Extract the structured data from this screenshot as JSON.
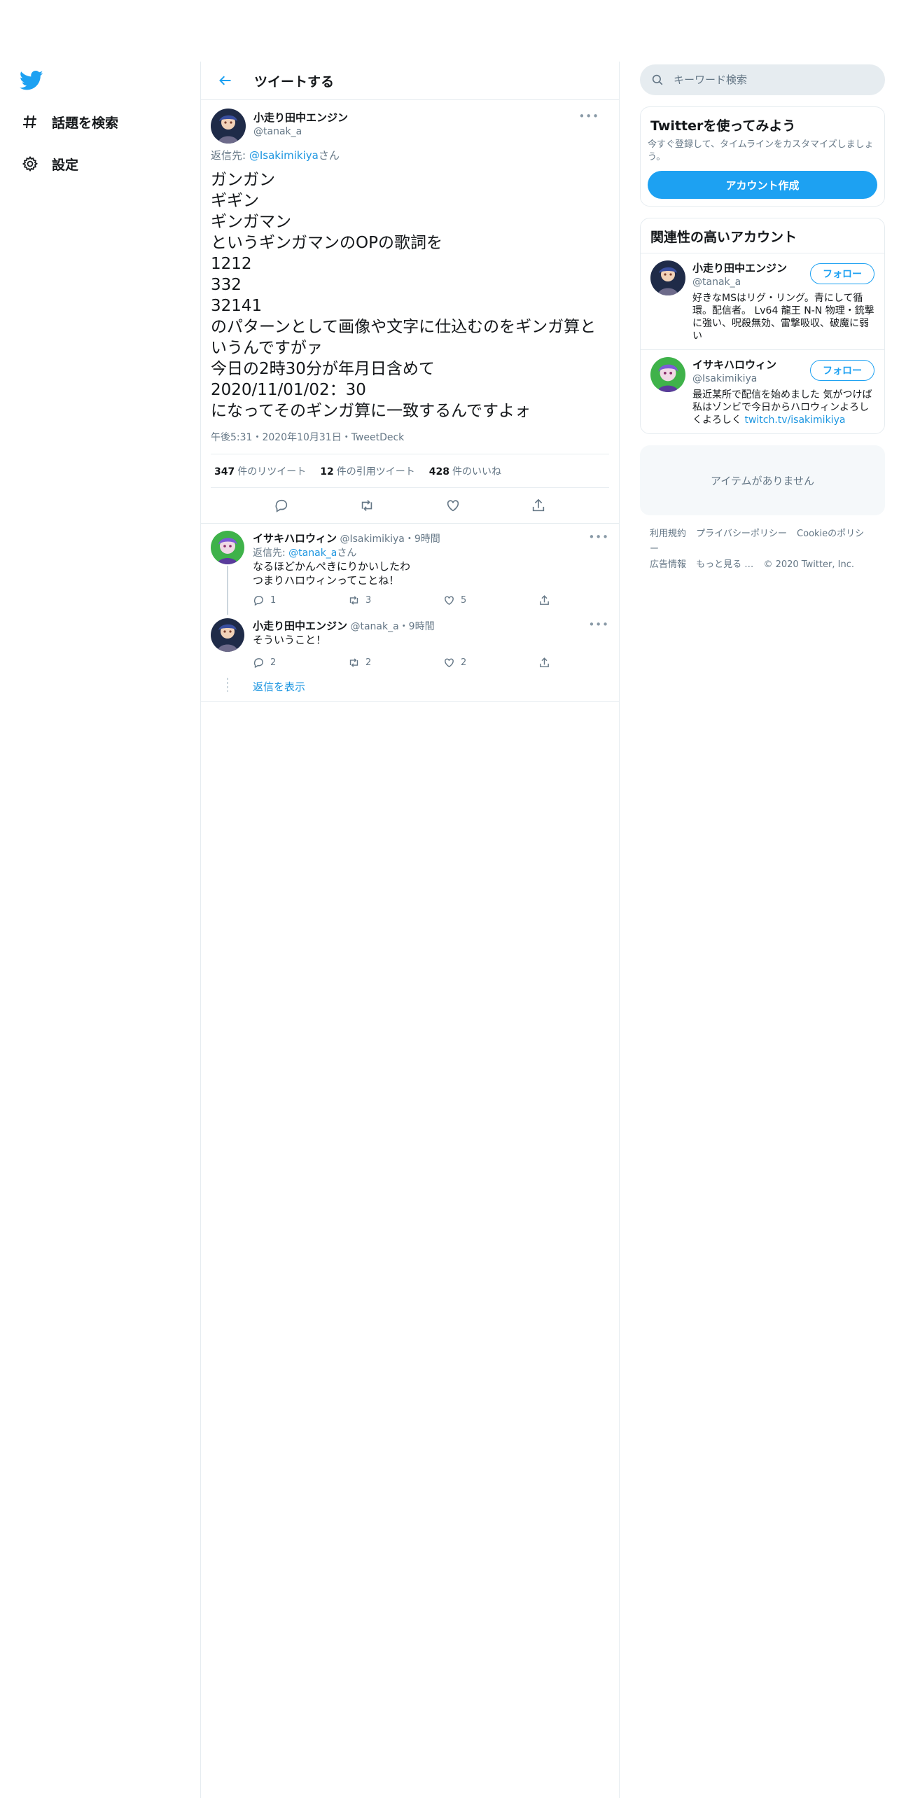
{
  "nav": {
    "items": [
      {
        "label": "話題を検索",
        "icon": "hashtag-icon"
      },
      {
        "label": "設定",
        "icon": "gear-icon"
      }
    ]
  },
  "header": {
    "title": "ツイートする"
  },
  "main_tweet": {
    "name": "小走り田中エンジン",
    "handle": "@tanak_a",
    "replying_prefix": "返信先: ",
    "replying_handle": "@Isakimikiya",
    "replying_suffix": "さん",
    "text": "ガンガン\nギギン\nギンガマン\nというギンガマンのOPの歌詞を\n1212\n332\n32141\nのパターンとして画像や文字に仕込むのをギンガ算と\nいうんですがァ\n今日の2時30分が年月日含めて\n2020/11/01/02：30\nになってそのギンガ算に一致するんですよォ",
    "meta": "午後5:31・2020年10月31日・TweetDeck",
    "retweets": "347",
    "retweets_label": "件のリツイート",
    "quotes": "12",
    "quotes_label": "件の引用ツイート",
    "likes": "428",
    "likes_label": "件のいいね"
  },
  "replies": [
    {
      "name": "イサキハロウィン",
      "handle": "@Isakimikiya",
      "time": "・9時間",
      "replying_prefix": "返信先: ",
      "replying_handle": "@tanak_a",
      "replying_suffix": "さん",
      "text": "なるほどかんぺきにりかいしたわ\nつまりハロウィンってことね！",
      "reply_count": "1",
      "retweet_count": "3",
      "like_count": "5"
    },
    {
      "name": "小走り田中エンジン",
      "handle": "@tanak_a",
      "time": "・9時間",
      "text": "そういうこと！",
      "reply_count": "2",
      "retweet_count": "2",
      "like_count": "2"
    }
  ],
  "show_replies": "返信を表示",
  "search": {
    "placeholder": "キーワード検索"
  },
  "signup": {
    "title": "Twitterを使ってみよう",
    "desc": "今すぐ登録して、タイムラインをカスタマイズしましょう。",
    "button": "アカウント作成"
  },
  "related": {
    "title": "関連性の高いアカウント",
    "follow_label": "フォロー",
    "accounts": [
      {
        "name": "小走り田中エンジン",
        "handle": "@tanak_a",
        "bio": "好きなMSはリグ・リング。青にして循環。配信者。 Lv64 龍王 N-N 物理・銃撃に強い、呪殺無効、雷撃吸収、破魔に弱い"
      },
      {
        "name": "イサキハロウィン",
        "handle": "@Isakimikiya",
        "bio": "最近某所で配信を始めました 気がつけば私はゾンビで今日からハロウィンよろしくよろしく ",
        "link": "twitch.tv/isakimikiya"
      }
    ]
  },
  "empty": "アイテムがありません",
  "footer": {
    "links": [
      "利用規約",
      "プライバシーポリシー",
      "Cookieのポリシー",
      "広告情報",
      "もっと見る …"
    ],
    "copyright": "© 2020 Twitter, Inc."
  },
  "colors": {
    "accent": "#1da1f2",
    "link": "#1b95e0",
    "muted": "#657786",
    "border": "#e6ecf0"
  }
}
